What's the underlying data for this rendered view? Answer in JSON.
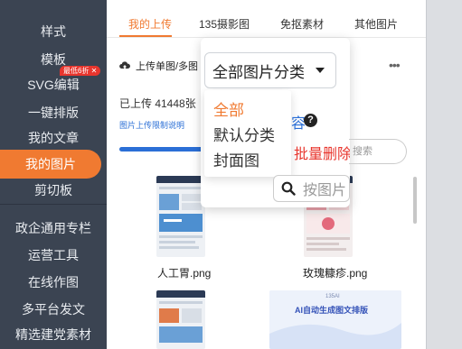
{
  "sidebar": {
    "items": [
      {
        "label": "样式"
      },
      {
        "label": "模板"
      },
      {
        "label": "SVG编辑"
      },
      {
        "label": "一键排版"
      },
      {
        "label": "我的文章"
      },
      {
        "label": "我的图片"
      },
      {
        "label": "剪切板"
      },
      {
        "label": "政企通用专栏"
      },
      {
        "label": "运营工具"
      },
      {
        "label": "在线作图"
      },
      {
        "label": "多平台发文"
      },
      {
        "label": "精选建党素材"
      }
    ],
    "badge": "最低6折",
    "active_index": 5
  },
  "tabs": [
    {
      "label": "我的上传"
    },
    {
      "label": "135摄影图"
    },
    {
      "label": "免抠素材"
    },
    {
      "label": "其他图片"
    }
  ],
  "toolbar": {
    "upload_label": "上传单图/多图",
    "more": "•••"
  },
  "stats": {
    "uploaded": "已上传 41448张",
    "limit_link": "图片上传限制说明",
    "progress": 1.0
  },
  "category_select": {
    "value": "全部图片分类",
    "options": [
      "全部",
      "默认分类",
      "封面图"
    ],
    "selected_index": 0
  },
  "actions": {
    "content_link": "容",
    "help": "?",
    "bulk_delete": "批量删除",
    "search_placeholder": "搜索",
    "search_by_image": "按图片"
  },
  "images": [
    {
      "name": "人工胃.png"
    },
    {
      "name": "玫瑰糠疹.png"
    },
    {
      "name": ""
    },
    {
      "name": ""
    }
  ],
  "thumb_text": {
    "ai_title": "AI自动生成图文排版",
    "ai_brand": "135AI"
  },
  "colors": {
    "sidebar_bg": "#3b4452",
    "accent": "#f07a31",
    "link": "#2b6fd6",
    "danger": "#e8352d"
  }
}
